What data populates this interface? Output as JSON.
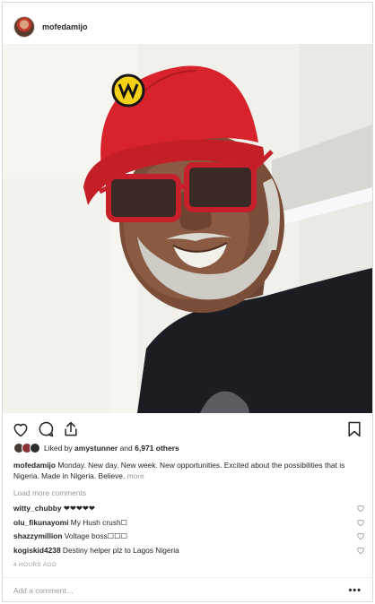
{
  "post": {
    "username": "mofedamijo",
    "image_alt": "Man in red cap and red glasses smiling"
  },
  "likes": {
    "prefix": "Liked by ",
    "liker": "amystunner",
    "middle": " and ",
    "others": "6,971 others"
  },
  "caption": {
    "username": "mofedamijo",
    "text": " Monday. New day. New week. New opportunities. Excited about the possibilities that is Nigeria. Made in Nigeria. Believe. ",
    "more": "more"
  },
  "load_more": "Load more comments",
  "comments": [
    {
      "user": "witty_chubby",
      "text": " ❤❤❤❤❤"
    },
    {
      "user": "olu_fikunayomi",
      "text": " My Hush crush☐"
    },
    {
      "user": "shazzymillion",
      "text": " Voltage boss☐☐☐"
    },
    {
      "user": "kogiskid4238",
      "text": " Destiny helper plz to Lagos Nigeria"
    }
  ],
  "timestamp": "4 HOURS AGO",
  "add_comment": {
    "placeholder": "Add a comment…"
  },
  "icons": {
    "like": "heart-icon",
    "comment": "comment-icon",
    "share": "share-icon",
    "save": "bookmark-icon",
    "options": "more-options-icon"
  },
  "colors": {
    "cap": "#d6262e",
    "text": "#262626",
    "muted": "#999999"
  }
}
